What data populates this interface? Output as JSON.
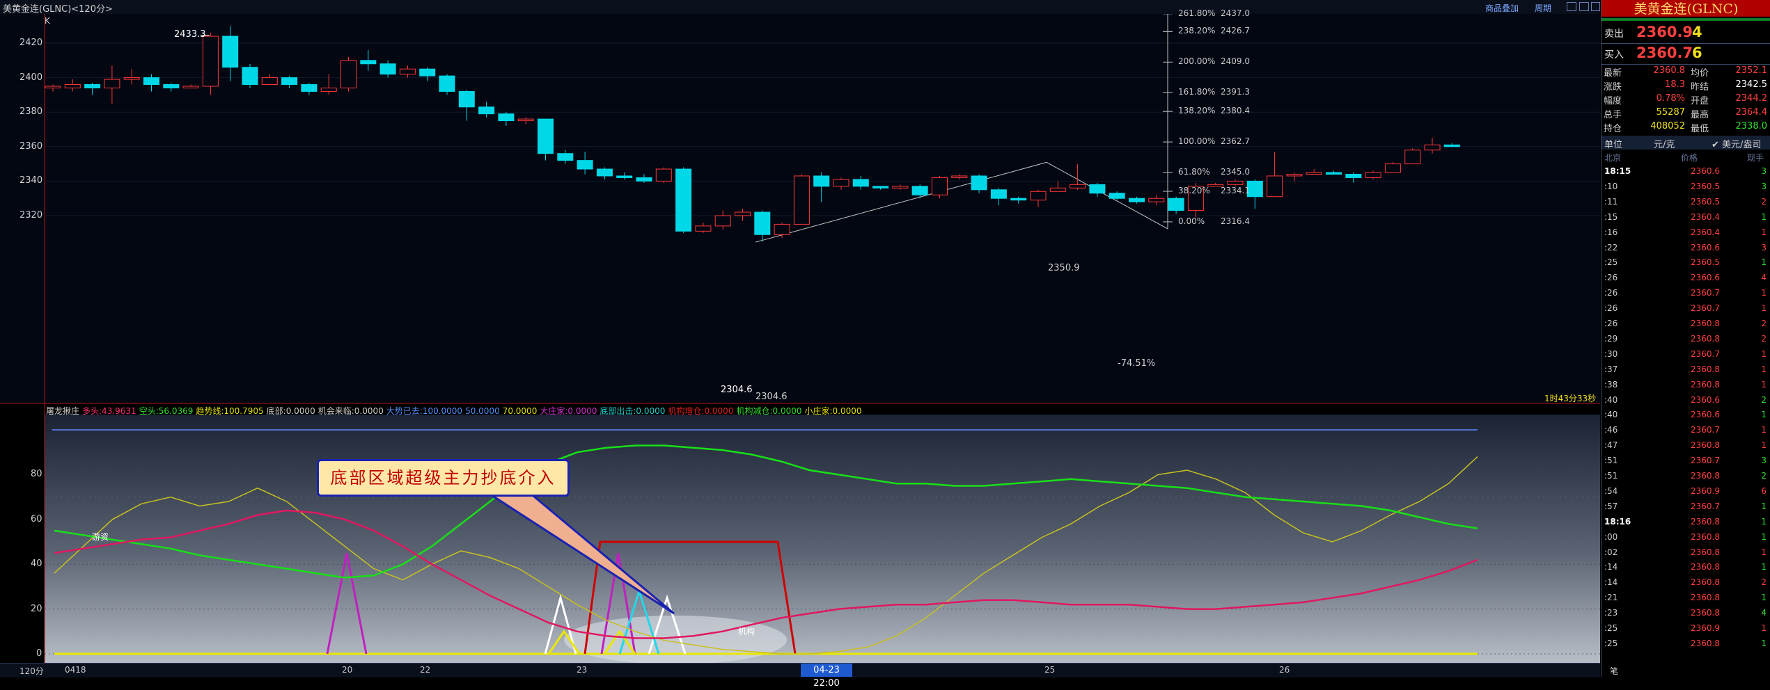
{
  "window": {
    "title": "美黄金连(GLNC)<120分>",
    "links": [
      "商品叠加",
      "周期"
    ]
  },
  "main_chart": {
    "indicator_k": "K",
    "y_ticks": [
      2420,
      2400,
      2380,
      2360,
      2340,
      2320
    ],
    "candles": [
      [
        2394,
        2395,
        2392,
        2396
      ],
      [
        2394,
        2396,
        2392,
        2399
      ],
      [
        2396,
        2394,
        2390,
        2397
      ],
      [
        2394,
        2399,
        2385,
        2407
      ],
      [
        2399,
        2400,
        2396,
        2405
      ],
      [
        2400,
        2396,
        2392,
        2402
      ],
      [
        2396,
        2394,
        2392,
        2397
      ],
      [
        2394,
        2395,
        2394,
        2396
      ],
      [
        2395,
        2424,
        2390,
        2426
      ],
      [
        2424,
        2406,
        2398,
        2430
      ],
      [
        2406,
        2396,
        2394,
        2408
      ],
      [
        2396,
        2400,
        2396,
        2402
      ],
      [
        2400,
        2396,
        2394,
        2401
      ],
      [
        2396,
        2392,
        2390,
        2397
      ],
      [
        2392,
        2394,
        2390,
        2402
      ],
      [
        2394,
        2410,
        2392,
        2412
      ],
      [
        2410,
        2408,
        2404,
        2416
      ],
      [
        2408,
        2402,
        2400,
        2410
      ],
      [
        2402,
        2405,
        2400,
        2407
      ],
      [
        2405,
        2401,
        2398,
        2406
      ],
      [
        2401,
        2392,
        2390,
        2402
      ],
      [
        2392,
        2383,
        2375,
        2393
      ],
      [
        2383,
        2379,
        2377,
        2386
      ],
      [
        2379,
        2375,
        2372,
        2380
      ],
      [
        2375,
        2376,
        2373,
        2377
      ],
      [
        2376,
        2356,
        2352,
        2376
      ],
      [
        2356,
        2352,
        2350,
        2358
      ],
      [
        2352,
        2347,
        2344,
        2357
      ],
      [
        2347,
        2343,
        2341,
        2348
      ],
      [
        2343,
        2342,
        2341,
        2345
      ],
      [
        2342,
        2340,
        2339,
        2344
      ],
      [
        2340,
        2347,
        2339,
        2348
      ],
      [
        2347,
        2311,
        2310,
        2348
      ],
      [
        2311,
        2314,
        2310,
        2316
      ],
      [
        2314,
        2320,
        2312,
        2323
      ],
      [
        2320,
        2322,
        2317,
        2324
      ],
      [
        2322,
        2309,
        2305,
        2323
      ],
      [
        2309,
        2315,
        2307,
        2316
      ],
      [
        2315,
        2343,
        2315,
        2344
      ],
      [
        2343,
        2337,
        2328,
        2345
      ],
      [
        2337,
        2341,
        2335,
        2342
      ],
      [
        2341,
        2337,
        2335,
        2343
      ],
      [
        2337,
        2336,
        2335,
        2337
      ],
      [
        2336,
        2337,
        2335,
        2338
      ],
      [
        2337,
        2332,
        2330,
        2338
      ],
      [
        2332,
        2342,
        2330,
        2343
      ],
      [
        2342,
        2343,
        2341,
        2344
      ],
      [
        2343,
        2335,
        2333,
        2344
      ],
      [
        2335,
        2330,
        2326,
        2336
      ],
      [
        2330,
        2329,
        2327,
        2331
      ],
      [
        2329,
        2334,
        2325,
        2335
      ],
      [
        2334,
        2336,
        2334,
        2340
      ],
      [
        2336,
        2338,
        2335,
        2350
      ],
      [
        2338,
        2333,
        2331,
        2339
      ],
      [
        2333,
        2330,
        2329,
        2334
      ],
      [
        2330,
        2328,
        2327,
        2331
      ],
      [
        2328,
        2330,
        2326,
        2332
      ],
      [
        2330,
        2323,
        2321,
        2331
      ],
      [
        2323,
        2337,
        2319,
        2339
      ],
      [
        2337,
        2338,
        2337,
        2339
      ],
      [
        2338,
        2340,
        2337,
        2341
      ],
      [
        2340,
        2331,
        2324,
        2341
      ],
      [
        2331,
        2343,
        2331,
        2357
      ],
      [
        2343,
        2344,
        2340,
        2345
      ],
      [
        2344,
        2345,
        2344,
        2347
      ],
      [
        2345,
        2344,
        2344,
        2346
      ],
      [
        2344,
        2342,
        2339,
        2345
      ],
      [
        2342,
        2345,
        2341,
        2346
      ],
      [
        2345,
        2350,
        2345,
        2351
      ],
      [
        2350,
        2358,
        2350,
        2359
      ],
      [
        2358,
        2361,
        2356,
        2365
      ],
      [
        2361,
        2360,
        2360,
        2362
      ]
    ],
    "annotations": {
      "high": "2433.3",
      "low": "2304.6",
      "low2": "2304.6",
      "peak": "2350.9",
      "pct": "-74.51%"
    },
    "fib_levels": [
      {
        "pct": "261.80%",
        "price": "2437.0",
        "y": 2437.0
      },
      {
        "pct": "238.20%",
        "price": "2426.7",
        "y": 2426.7
      },
      {
        "pct": "200.00%",
        "price": "2409.0",
        "y": 2409.0
      },
      {
        "pct": "161.80%",
        "price": "2391.3",
        "y": 2391.3
      },
      {
        "pct": "138.20%",
        "price": "2380.4",
        "y": 2380.4
      },
      {
        "pct": "100.00%",
        "price": "2362.7",
        "y": 2362.7
      },
      {
        "pct": "61.80%",
        "price": "2345.0",
        "y": 2345.0
      },
      {
        "pct": "38.20%",
        "price": "2334.1",
        "y": 2334.1
      },
      {
        "pct": "0.00%",
        "price": "2316.4",
        "y": 2316.4
      }
    ],
    "countdown": "1时43分33秒"
  },
  "indicator": {
    "legend": [
      {
        "text": "屠龙揪庄",
        "color": "#d0d0d0"
      },
      {
        "text": "多头:43.9631",
        "color": "#ff3070"
      },
      {
        "text": "空头:56.0369",
        "color": "#30e030"
      },
      {
        "text": "趋势线:100.7905",
        "color": "#e0e000"
      },
      {
        "text": "底部:0.0000",
        "color": "#d0d0d0"
      },
      {
        "text": "机会来临:0.0000",
        "color": "#d0d0d0"
      },
      {
        "text": "大势已去:100.0000",
        "color": "#5090ff"
      },
      {
        "text": "50.0000",
        "color": "#5090ff"
      },
      {
        "text": "70.0000",
        "color": "#e0e000"
      },
      {
        "text": "大庄家:0.0000",
        "color": "#d030d0"
      },
      {
        "text": "底部出击:0.0000",
        "color": "#20d0d0"
      },
      {
        "text": "机构增仓:0.0000",
        "color": "#e02020"
      },
      {
        "text": "机构减仓:0.0000",
        "color": "#30e030"
      },
      {
        "text": "小庄家:0.0000",
        "color": "#e0e000"
      }
    ],
    "y_ticks": [
      80,
      60,
      40,
      20,
      0
    ],
    "labels": {
      "youzi": "游资",
      "jigou": "机构"
    },
    "callout": "底部区域超级主力抄底介入",
    "series": {
      "bull": [
        45,
        47,
        49,
        51,
        52,
        55,
        58,
        62,
        64,
        63,
        60,
        55,
        48,
        40,
        33,
        26,
        20,
        14,
        10,
        8,
        7,
        7,
        8,
        10,
        13,
        16,
        18,
        20,
        21,
        22,
        22,
        23,
        24,
        24,
        23,
        22,
        22,
        22,
        21,
        20,
        20,
        21,
        22,
        23,
        25,
        27,
        30,
        33,
        37,
        42
      ],
      "bear": [
        55,
        53,
        51,
        49,
        47,
        44,
        42,
        40,
        38,
        36,
        34,
        35,
        40,
        48,
        58,
        68,
        78,
        85,
        90,
        92,
        93,
        93,
        92,
        91,
        89,
        86,
        82,
        80,
        78,
        76,
        76,
        75,
        75,
        76,
        77,
        78,
        77,
        76,
        75,
        74,
        72,
        70,
        69,
        68,
        67,
        66,
        64,
        61,
        58,
        56
      ],
      "yellow": [
        36,
        48,
        60,
        67,
        70,
        66,
        68,
        74,
        68,
        58,
        48,
        38,
        33,
        40,
        46,
        43,
        38,
        30,
        22,
        15,
        10,
        6,
        4,
        2,
        1,
        0,
        0,
        1,
        3,
        8,
        16,
        26,
        36,
        44,
        52,
        58,
        66,
        72,
        80,
        82,
        78,
        72,
        62,
        54,
        50,
        55,
        62,
        68,
        76,
        88
      ],
      "trend_line_value": 100
    }
  },
  "x_axis": {
    "period": "120分",
    "labels": [
      "0418",
      "20",
      "22",
      "23",
      "25",
      "26"
    ],
    "highlight": "04-23 22:00"
  },
  "quote": {
    "title": "美黄金连(GLNC)",
    "sell_label": "卖出",
    "sell_price": "2360.9",
    "sell_qty": "4",
    "buy_label": "买入",
    "buy_price": "2360.7",
    "buy_qty": "6",
    "stats": [
      {
        "l1": "最新",
        "v1": "2360.8",
        "c1": "#ff4040",
        "l2": "均价",
        "v2": "2352.1",
        "c2": "#ff4040"
      },
      {
        "l1": "涨跌",
        "v1": "18.3",
        "c1": "#ff4040",
        "l2": "昨结",
        "v2": "2342.5",
        "c2": "#ffffff"
      },
      {
        "l1": "幅度",
        "v1": "0.78%",
        "c1": "#ff4040",
        "l2": "开盘",
        "v2": "2344.2",
        "c2": "#ff4040"
      },
      {
        "l1": "总手",
        "v1": "55287",
        "c1": "#f0e020",
        "l2": "最高",
        "v2": "2364.4",
        "c2": "#ff4040"
      },
      {
        "l1": "持仓",
        "v1": "408052",
        "c1": "#f0e020",
        "l2": "最低",
        "v2": "2338.0",
        "c2": "#30e030"
      }
    ],
    "unit_label": "单位",
    "unit_value": "元/克",
    "unit_alt": "✔ 美元/盎司",
    "col_headers": [
      "北京",
      "价格",
      "现手"
    ],
    "ticks": [
      {
        "t": "18:15",
        "p": "2360.6",
        "v": "3",
        "vc": "#30e030",
        "bold": true
      },
      {
        "t": ":10",
        "p": "2360.5",
        "v": "3",
        "vc": "#30e030"
      },
      {
        "t": ":11",
        "p": "2360.5",
        "v": "2",
        "vc": "#ff4040"
      },
      {
        "t": ":15",
        "p": "2360.4",
        "v": "1",
        "vc": "#30e030"
      },
      {
        "t": ":16",
        "p": "2360.4",
        "v": "1",
        "vc": "#ff4040"
      },
      {
        "t": ":22",
        "p": "2360.6",
        "v": "3",
        "vc": "#ff4040"
      },
      {
        "t": ":25",
        "p": "2360.5",
        "v": "1",
        "vc": "#30e030"
      },
      {
        "t": ":26",
        "p": "2360.6",
        "v": "4",
        "vc": "#ff4040"
      },
      {
        "t": ":26",
        "p": "2360.7",
        "v": "1",
        "vc": "#ff4040"
      },
      {
        "t": ":26",
        "p": "2360.7",
        "v": "1",
        "vc": "#ff4040"
      },
      {
        "t": ":26",
        "p": "2360.8",
        "v": "2",
        "vc": "#ff4040"
      },
      {
        "t": ":29",
        "p": "2360.8",
        "v": "2",
        "vc": "#ff4040"
      },
      {
        "t": ":30",
        "p": "2360.7",
        "v": "1",
        "vc": "#ff4040"
      },
      {
        "t": ":37",
        "p": "2360.8",
        "v": "1",
        "vc": "#ff4040"
      },
      {
        "t": ":38",
        "p": "2360.8",
        "v": "1",
        "vc": "#ff4040"
      },
      {
        "t": ":40",
        "p": "2360.6",
        "v": "2",
        "vc": "#30e030"
      },
      {
        "t": ":40",
        "p": "2360.6",
        "v": "1",
        "vc": "#30e030"
      },
      {
        "t": ":46",
        "p": "2360.7",
        "v": "1",
        "vc": "#ff4040"
      },
      {
        "t": ":47",
        "p": "2360.8",
        "v": "1",
        "vc": "#ff4040"
      },
      {
        "t": ":51",
        "p": "2360.7",
        "v": "3",
        "vc": "#30e030"
      },
      {
        "t": ":51",
        "p": "2360.8",
        "v": "2",
        "vc": "#30e030"
      },
      {
        "t": ":54",
        "p": "2360.9",
        "v": "6",
        "vc": "#ff4040"
      },
      {
        "t": ":57",
        "p": "2360.7",
        "v": "1",
        "vc": "#30e030"
      },
      {
        "t": "18:16",
        "p": "2360.8",
        "v": "1",
        "vc": "#30e030",
        "bold": true
      },
      {
        "t": ":00",
        "p": "2360.8",
        "v": "1",
        "vc": "#30e030"
      },
      {
        "t": ":02",
        "p": "2360.8",
        "v": "1",
        "vc": "#ff4040"
      },
      {
        "t": ":14",
        "p": "2360.8",
        "v": "1",
        "vc": "#30e030"
      },
      {
        "t": ":14",
        "p": "2360.8",
        "v": "2",
        "vc": "#ff4040"
      },
      {
        "t": ":21",
        "p": "2360.8",
        "v": "1",
        "vc": "#30e030"
      },
      {
        "t": ":23",
        "p": "2360.8",
        "v": "4",
        "vc": "#30e030"
      },
      {
        "t": ":25",
        "p": "2360.9",
        "v": "1",
        "vc": "#ff4040"
      },
      {
        "t": ":25",
        "p": "2360.8",
        "v": "1",
        "vc": "#30e030"
      }
    ],
    "footer": "笔"
  }
}
